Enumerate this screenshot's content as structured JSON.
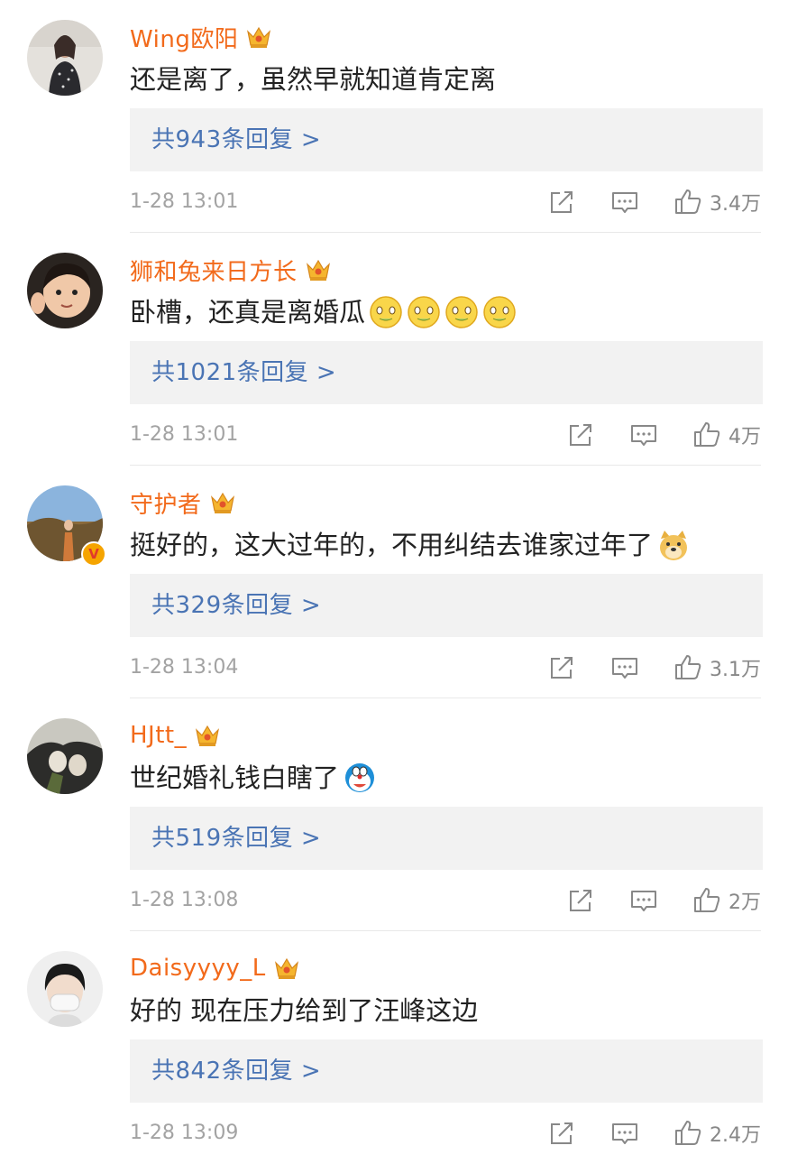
{
  "comments": [
    {
      "username": "Wing欧阳",
      "text": "还是离了，虽然早就知道肯定离",
      "emojis": [],
      "replies": "共943条回复 >",
      "time": "1-28 13:01",
      "likes": "3.4万",
      "verified": false,
      "avatar": "avatar-woman-mirror-selfie"
    },
    {
      "username": "狮和兔来日方长",
      "text": "卧槽，还真是离婚瓜",
      "emojis": [
        "melon-emoji",
        "melon-emoji",
        "melon-emoji",
        "melon-emoji"
      ],
      "replies": "共1021条回复 >",
      "time": "1-28 13:01",
      "likes": "4万",
      "verified": false,
      "avatar": "avatar-child-waving"
    },
    {
      "username": "守护者",
      "text": "挺好的，这大过年的，不用纠结去谁家过年了",
      "emojis": [
        "doge-emoji"
      ],
      "replies": "共329条回复 >",
      "time": "1-28 13:04",
      "likes": "3.1万",
      "verified": true,
      "verified_mark": "V",
      "avatar": "avatar-person-landscape"
    },
    {
      "username": "HJtt_",
      "text": "世纪婚礼钱白瞎了",
      "emojis": [
        "doraemon-emoji"
      ],
      "replies": "共519条回复 >",
      "time": "1-28 13:08",
      "likes": "2万",
      "verified": false,
      "avatar": "avatar-anime-couple"
    },
    {
      "username": "Daisyyyy_L",
      "text": "好的 现在压力给到了汪峰这边",
      "emojis": [],
      "replies": "共842条回复 >",
      "time": "1-28 13:09",
      "likes": "2.4万",
      "verified": false,
      "avatar": "avatar-person-mask"
    }
  ],
  "colors": {
    "username": "#f26a1b",
    "reply_link": "#4a74b4",
    "reply_bg": "#f2f2f2",
    "text": "#222222",
    "meta": "#a3a3a3"
  }
}
